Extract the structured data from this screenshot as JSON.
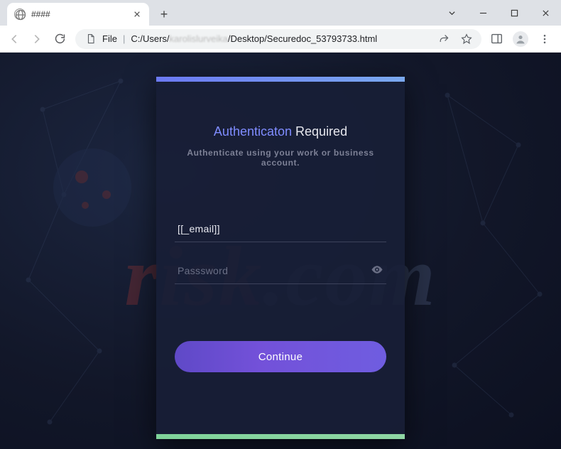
{
  "window": {
    "tab_title": "####",
    "addr_scheme": "File",
    "addr_path_prefix": "C:/Users/",
    "addr_path_blur": "karolislurveika",
    "addr_path_suffix": "/Desktop/Securedoc_53793733.html"
  },
  "page": {
    "title_brand": "Authenticaton",
    "title_rest": "Required",
    "subtitle": "Authenticate using your work or business account.",
    "email_value": "[[_email]]",
    "email_placeholder": "",
    "password_value": "",
    "password_placeholder": "Passsword",
    "continue_label": "Continue"
  },
  "watermark": {
    "a": "risk",
    "dot": ".",
    "b": "com"
  },
  "colors": {
    "card_top": "#6f82f0",
    "card_bottom": "#86d3a1",
    "button": "#6a52d3",
    "brand": "#7f8cff"
  }
}
